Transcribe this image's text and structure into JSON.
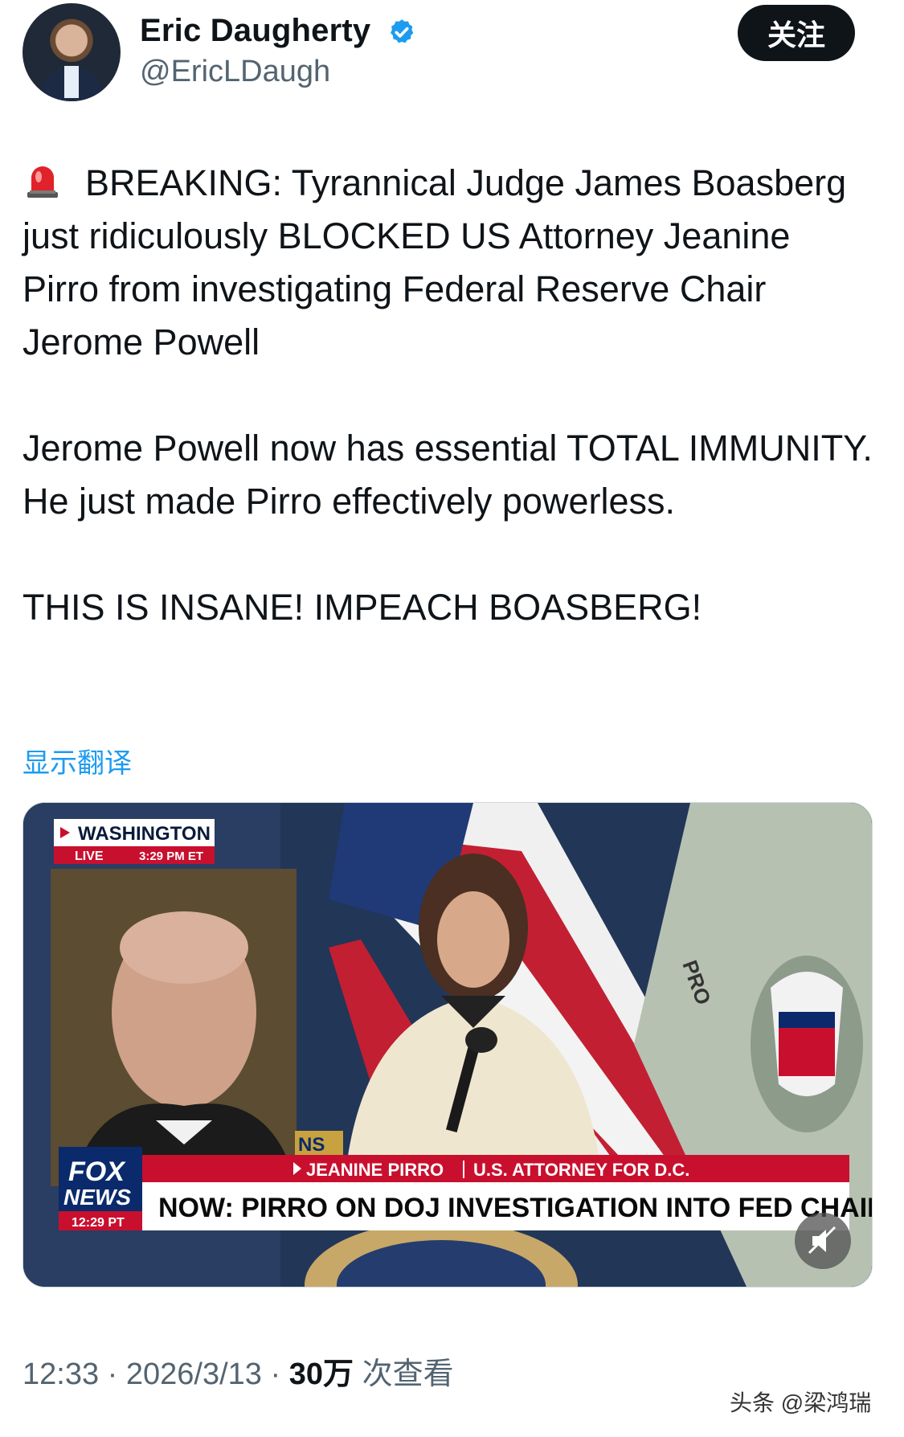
{
  "author": {
    "name": "Eric Daugherty",
    "handle": "@EricLDaugh",
    "verified_color": "#1d9bf0"
  },
  "follow_button": {
    "label": "关注"
  },
  "tweet": {
    "icon": "rotating-light-siren-icon",
    "paragraph1": "BREAKING: Tyrannical Judge James Boasberg just ridiculously BLOCKED US Attorney Jeanine Pirro from investigating Federal Reserve Chair Jerome Powell",
    "paragraph2": "Jerome Powell now has essential TOTAL IMMUNITY. He just made Pirro effectively powerless.",
    "paragraph3": "THIS IS INSANE! IMPEACH BOASBERG!"
  },
  "translate_link": "显示翻译",
  "media": {
    "location": "WASHINGTON",
    "live": "LIVE",
    "live_time": "3:29 PM ET",
    "lower_third_tag": "NS",
    "speaker_line": "JEANINE PIRRO",
    "speaker_title": "U.S. ATTORNEY FOR D.C.",
    "headline": "NOW: PIRRO ON DOJ INVESTIGATION INTO FED CHAIR",
    "network_top": "FOX",
    "network_bottom": "NEWS",
    "network_time": "12:29 PT",
    "flag_text": "PRO",
    "mute_icon": "speaker-muted-icon",
    "brand_red": "#c8102e",
    "brand_navy": "#0a2a6b"
  },
  "footer": {
    "time": "12:33",
    "sep1": "·",
    "date": "2026/3/13",
    "sep2": "·",
    "views_count": "30万",
    "views_label": "次查看"
  },
  "watermark": "头条 @梁鸿瑞"
}
